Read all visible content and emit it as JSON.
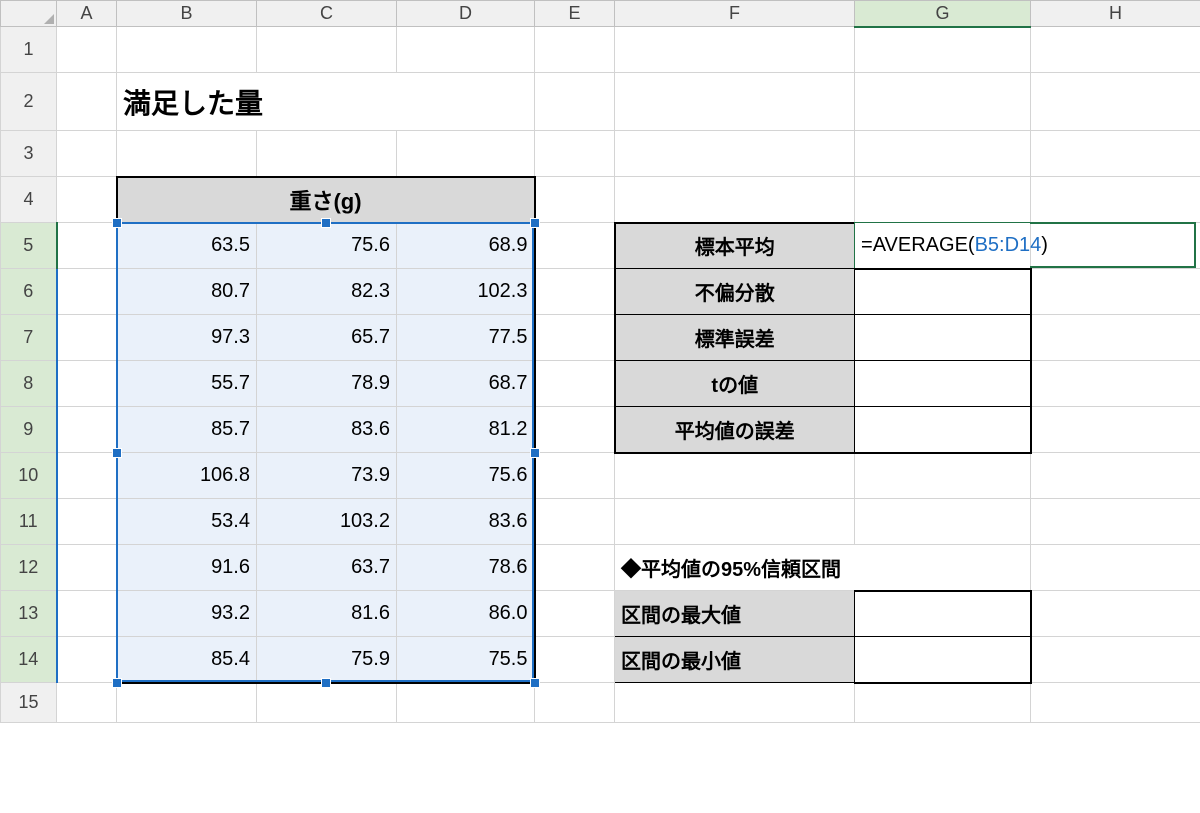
{
  "columns": [
    "A",
    "B",
    "C",
    "D",
    "E",
    "F",
    "G",
    "H"
  ],
  "rows": [
    "1",
    "2",
    "3",
    "4",
    "5",
    "6",
    "7",
    "8",
    "9",
    "10",
    "11",
    "12",
    "13",
    "14",
    "15"
  ],
  "title": "満足した量",
  "weight_header": "重さ(g)",
  "weight_data": [
    [
      "63.5",
      "75.6",
      "68.9"
    ],
    [
      "80.7",
      "82.3",
      "102.3"
    ],
    [
      "97.3",
      "65.7",
      "77.5"
    ],
    [
      "55.7",
      "78.9",
      "68.7"
    ],
    [
      "85.7",
      "83.6",
      "81.2"
    ],
    [
      "106.8",
      "73.9",
      "75.6"
    ],
    [
      "53.4",
      "103.2",
      "83.6"
    ],
    [
      "91.6",
      "63.7",
      "78.6"
    ],
    [
      "93.2",
      "81.6",
      "86.0"
    ],
    [
      "85.4",
      "75.9",
      "75.5"
    ]
  ],
  "stats_labels": [
    "標本平均",
    "不偏分散",
    "標準誤差",
    "tの値",
    "平均値の誤差"
  ],
  "formula": {
    "prefix": "=",
    "fn": "AVERAGE",
    "open": "(",
    "ref": "B5:D14",
    "close": ")"
  },
  "ci_title": "◆平均値の95%信頼区間",
  "ci_labels": [
    "区間の最大値",
    "区間の最小値"
  ],
  "active_col": "G",
  "selection_range": "B5:D14"
}
